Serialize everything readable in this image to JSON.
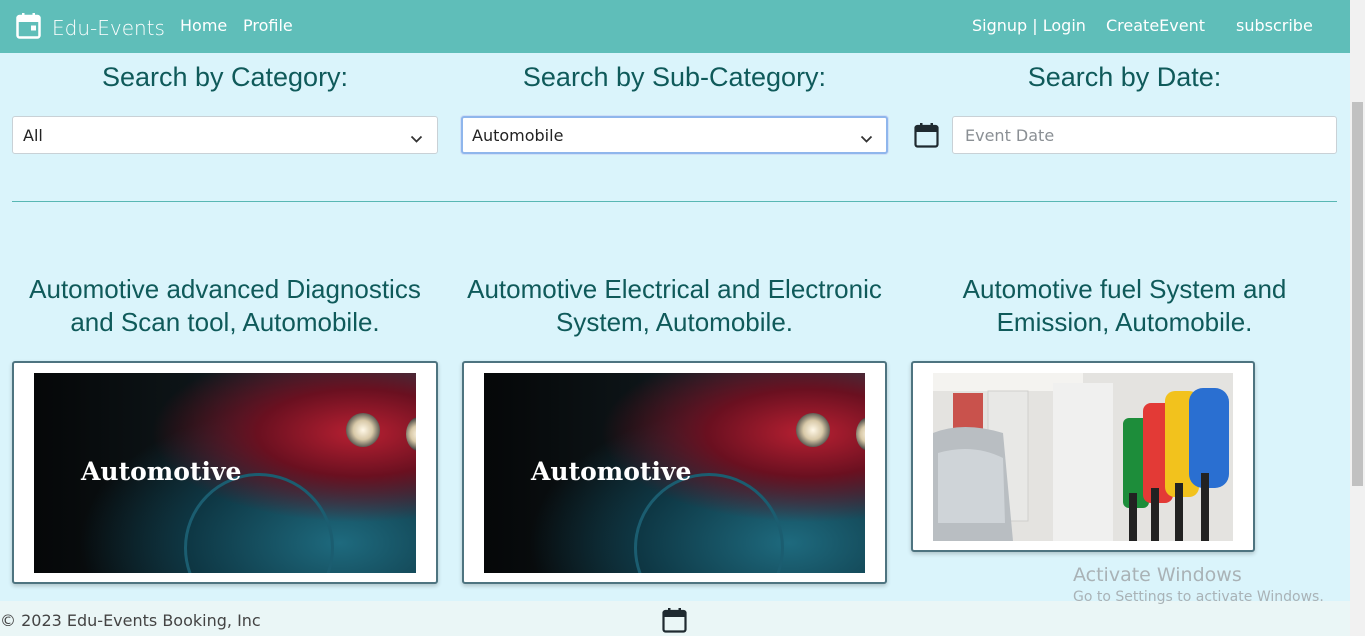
{
  "nav": {
    "brand": "Edu-Events",
    "links": [
      "Home",
      "Profile"
    ],
    "right_links": [
      "Signup | Login",
      "CreateEvent",
      "subscribe"
    ]
  },
  "search": {
    "category_heading": "Search by Category:",
    "subcategory_heading": "Search by Sub-Category:",
    "date_heading": "Search by Date:",
    "category_value": "All",
    "subcategory_value": "Automobile",
    "date_placeholder": "Event Date"
  },
  "events": [
    {
      "title": "Automotive advanced Diagnostics and Scan tool, Automobile.",
      "image_text": "Automotive"
    },
    {
      "title": "Automotive Electrical and Electronic System, Automobile.",
      "image_text": "Automotive"
    },
    {
      "title": "Automotive fuel System and Emission, Automobile.",
      "image_text": ""
    }
  ],
  "footer": {
    "copyright": "© 2023 Edu-Events Booking, Inc"
  },
  "watermark": {
    "title": "Activate Windows",
    "subtitle": "Go to Settings to activate Windows."
  },
  "colors": {
    "navbar": "#5fbeb9",
    "background": "#daf4fb",
    "heading": "#0f5a5a"
  },
  "icons": {
    "brand": "calendar-icon",
    "date": "calendar-icon",
    "select": "chevron-down-icon"
  }
}
